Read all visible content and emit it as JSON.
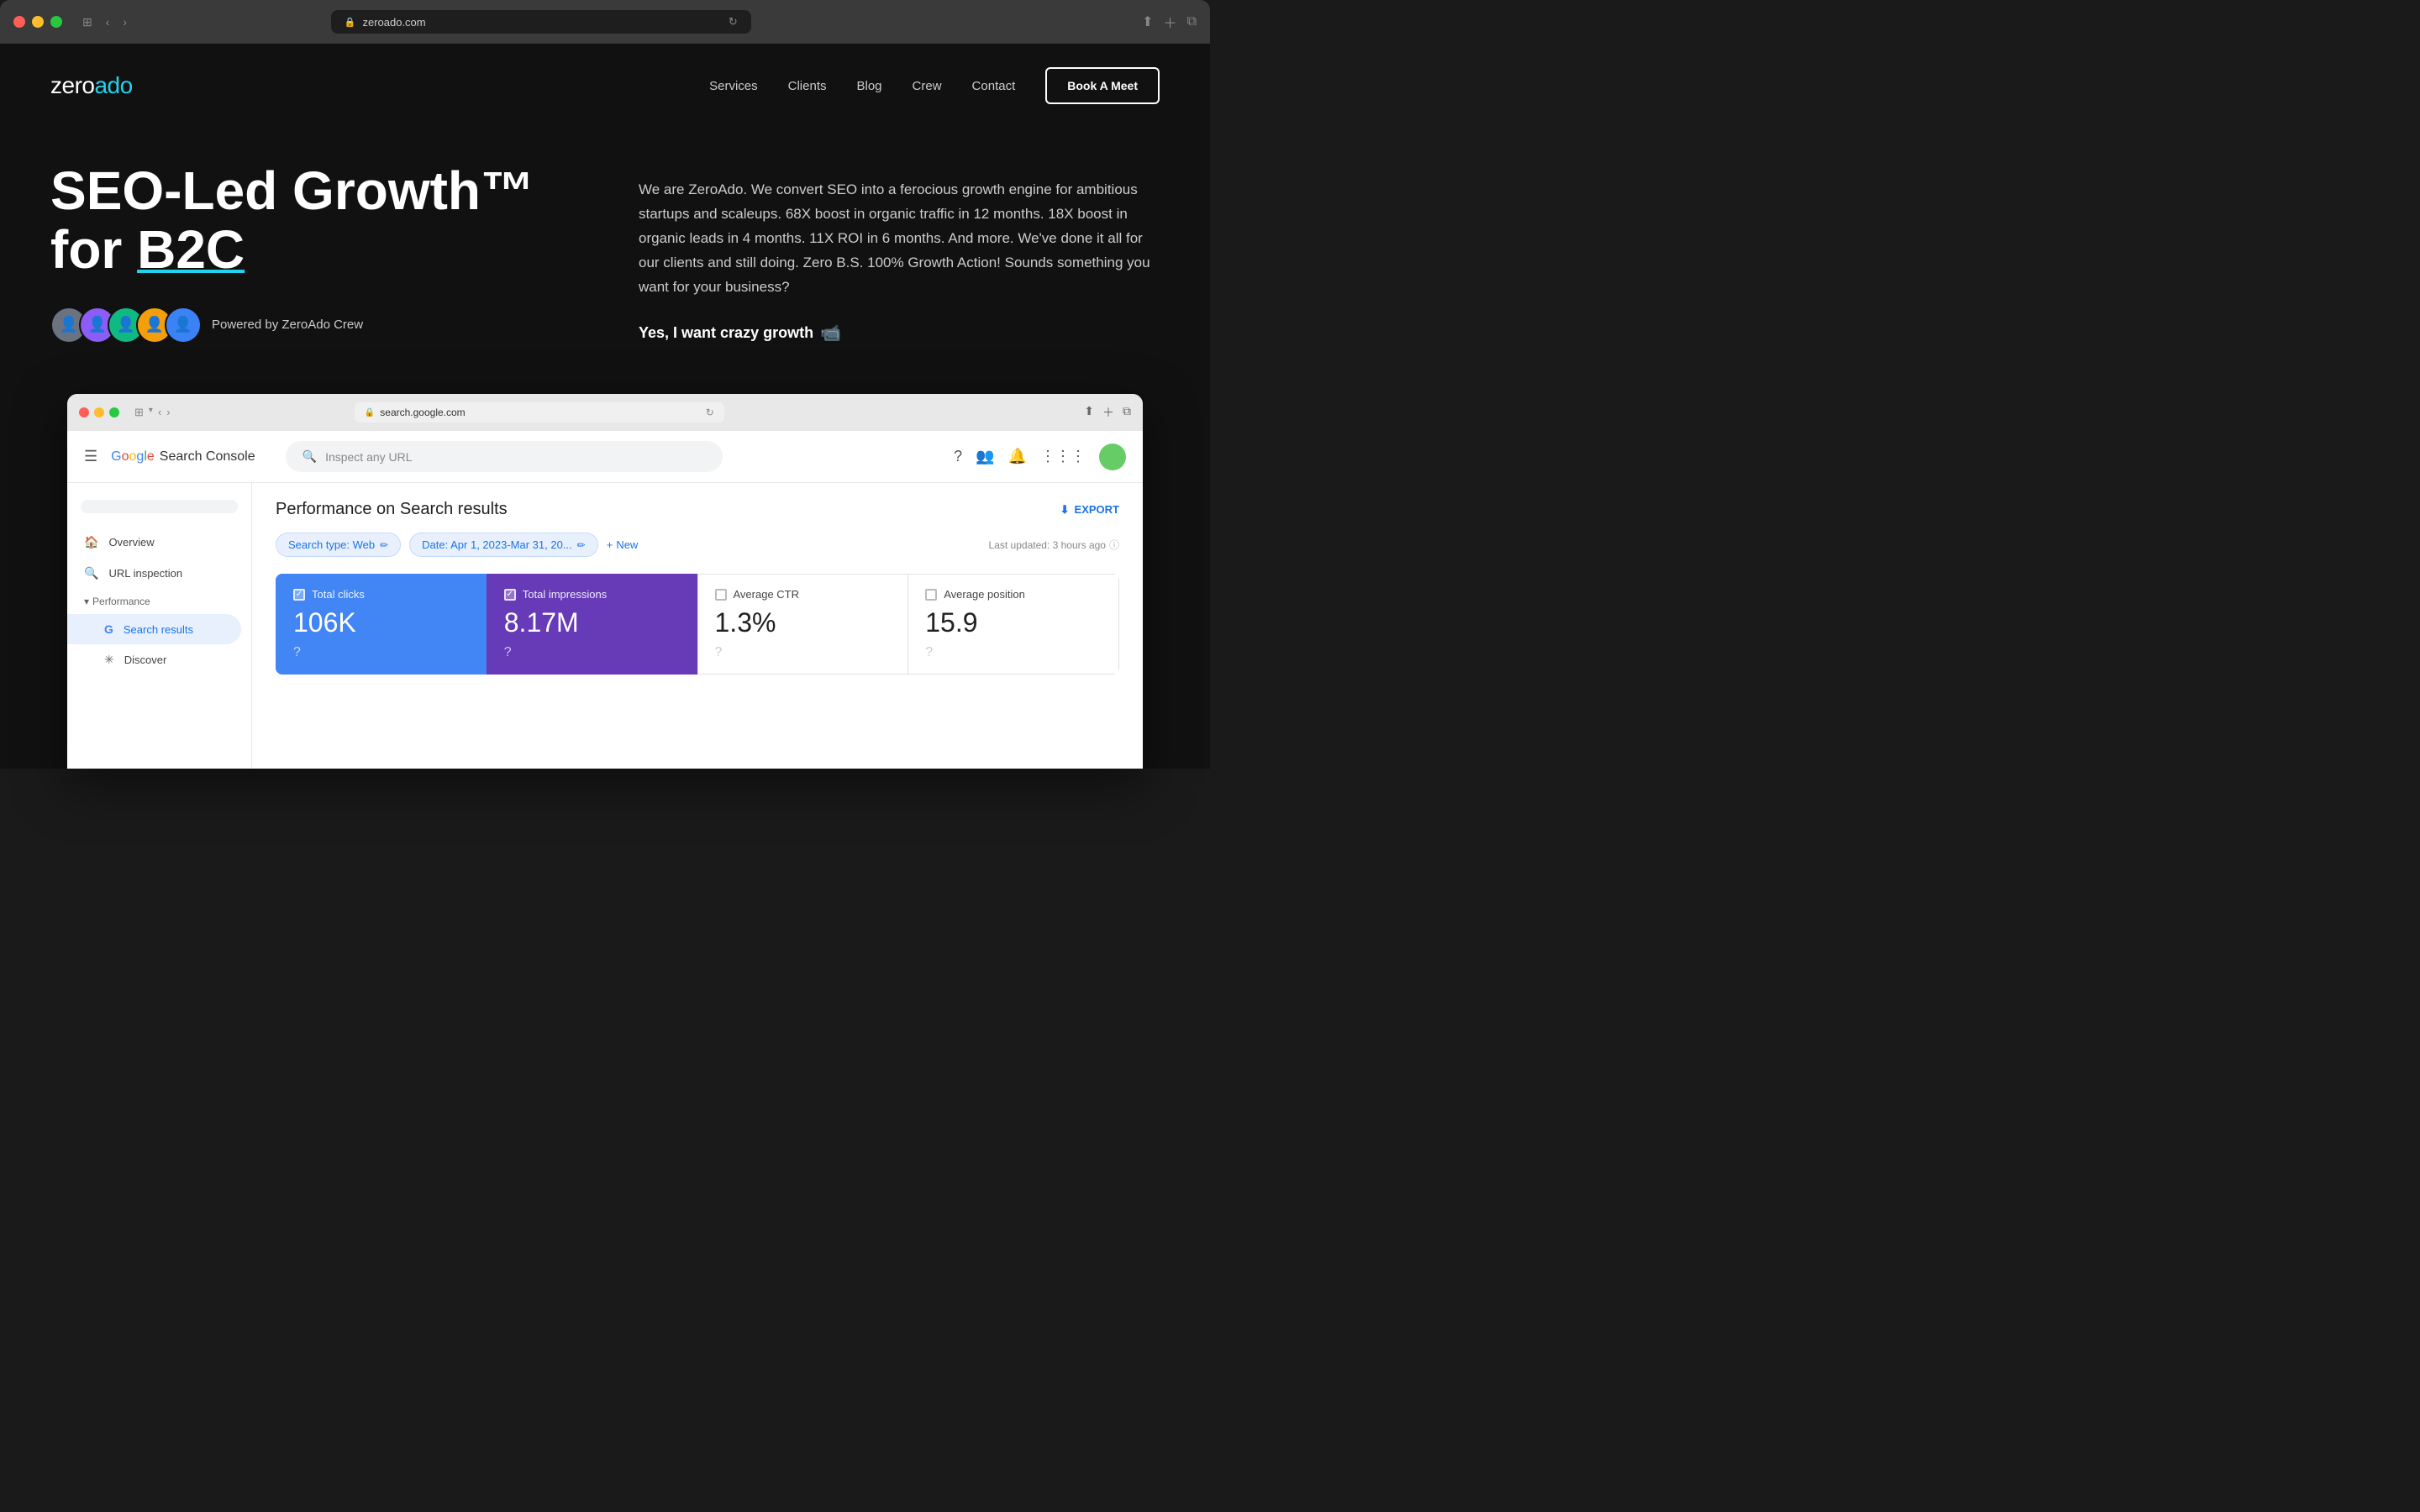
{
  "browser": {
    "url": "zeroado.com",
    "reload_icon": "↻"
  },
  "nav": {
    "logo_zero": "zero",
    "logo_ado": "ado",
    "links": [
      "Services",
      "Clients",
      "Blog",
      "Crew",
      "Contact"
    ],
    "cta": "Book A Meet"
  },
  "hero": {
    "title_line1": "SEO-Led Growth™",
    "title_line2": "for ",
    "title_b2c": "B2C",
    "description": "We are ZeroAdo. We convert SEO into a ferocious growth engine for ambitious startups and scaleups. 68X boost in organic traffic in 12 months. 18X boost in organic leads in 4 months. 11X ROI in 6 months. And more. We've done it all for our clients and still doing. Zero B.S. 100% Growth Action! Sounds something you want for your business?",
    "cta_text": "Yes, I want crazy growth",
    "cta_icon": "📹",
    "crew_label": "Powered by ZeroAdo Crew",
    "avatars": [
      "👤",
      "👤",
      "👤",
      "👤",
      "👤"
    ]
  },
  "inner_browser": {
    "url": "search.google.com"
  },
  "gsc": {
    "logo_text": "Search Console",
    "search_placeholder": "Inspect any URL",
    "sidebar": {
      "search_box_placeholder": "",
      "overview": "Overview",
      "url_inspection": "URL inspection",
      "performance_section": "Performance",
      "search_results": "Search results",
      "discover": "Discover"
    },
    "page_title": "Performance on Search results",
    "export_label": "EXPORT",
    "filters": {
      "search_type": "Search type: Web",
      "date": "Date: Apr 1, 2023-Mar 31, 20...",
      "new": "New",
      "last_updated": "Last updated: 3 hours ago"
    },
    "metrics": {
      "total_clicks": {
        "label": "Total clicks",
        "value": "106K",
        "checked": true
      },
      "total_impressions": {
        "label": "Total impressions",
        "value": "8.17M",
        "checked": true
      },
      "average_ctr": {
        "label": "Average CTR",
        "value": "1.3%",
        "checked": false
      },
      "average_position": {
        "label": "Average position",
        "value": "15.9",
        "checked": false
      }
    }
  }
}
